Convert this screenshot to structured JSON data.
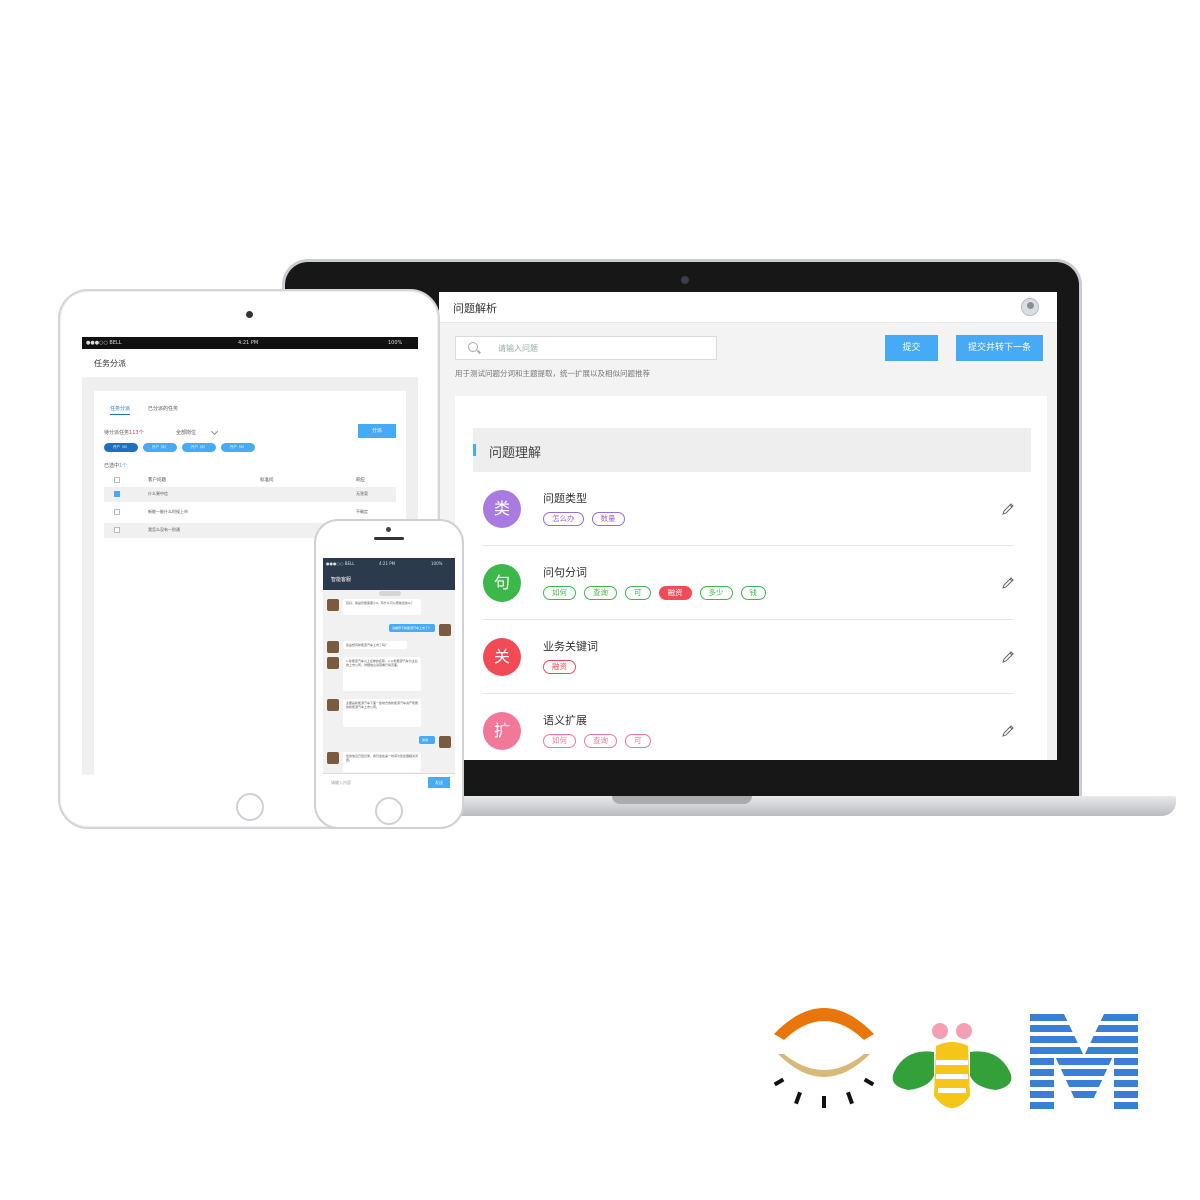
{
  "laptop": {
    "page_title": "问题解析",
    "search_placeholder": "请输入问题",
    "submit_label": "提交",
    "submit_next_label": "提交并转下一条",
    "hint": "用于测试问题分词和主题提取，统一扩展以及相似问题推荐",
    "section_title": "问题理解",
    "rows": [
      {
        "badge": "类",
        "badge_color": "#a97be0",
        "title": "问题类型",
        "tags": [
          {
            "text": "怎么办",
            "style": "purple"
          },
          {
            "text": "数量",
            "style": "purple"
          }
        ]
      },
      {
        "badge": "句",
        "badge_color": "#3cb84a",
        "title": "问句分词",
        "tags": [
          {
            "text": "如何",
            "style": "green"
          },
          {
            "text": "查询",
            "style": "green"
          },
          {
            "text": "可",
            "style": "green"
          },
          {
            "text": "融资",
            "style": "red-solid"
          },
          {
            "text": "多少",
            "style": "green"
          },
          {
            "text": "钱",
            "style": "green"
          }
        ]
      },
      {
        "badge": "关",
        "badge_color": "#f24b57",
        "title": "业务关键词",
        "tags": [
          {
            "text": "融资",
            "style": "red"
          }
        ]
      },
      {
        "badge": "扩",
        "badge_color": "#f2789a",
        "title": "语义扩展",
        "tags": [
          {
            "text": "如何",
            "style": "pink"
          },
          {
            "text": "查询",
            "style": "pink"
          },
          {
            "text": "可",
            "style": "pink"
          }
        ]
      }
    ],
    "colors": {
      "accent": "#47aaf7"
    }
  },
  "tablet": {
    "status_carrier": "●●●○○ BELL",
    "status_time": "4:21 PM",
    "status_battery": "100%",
    "nav_title": "任务分派",
    "tabs": [
      "任务分派",
      "已分派的任务"
    ],
    "pending_prefix": "待分派任务",
    "pending_count": "113",
    "pending_suffix": "个",
    "filter_value": "全部岗位",
    "assign_label": "分派",
    "chips": [
      "开户（8）",
      "开户（8）",
      "开户（8）",
      "开户（8）"
    ],
    "selected_prefix": "已选中",
    "selected_count": "1个",
    "headers": [
      "客户问题",
      "标准问",
      "响应"
    ],
    "rows": [
      {
        "question": "什么果中信",
        "answer": "无答案",
        "checked": true
      },
      {
        "question": "新能一能什么时候上市",
        "answer": "不确定",
        "checked": false
      },
      {
        "question": "我怎么没有一阶通",
        "answer": "",
        "checked": false
      }
    ]
  },
  "phone": {
    "status_carrier": "●●●○○ BELL",
    "status_time": "4:21 PM",
    "status_battery": "100%",
    "nav_title": "智能客服",
    "messages": [
      {
        "side": "in",
        "text": "您好，我是智能客服小S，有什么可以帮助您的么？"
      },
      {
        "side": "out",
        "text": "请推荐下新能源汽车上市了？"
      },
      {
        "side": "in",
        "text": "您是想问新能源汽车上市了吗？"
      },
      {
        "side": "in",
        "text": "1.新能源汽车以上证券的名称，2.以新能源汽车为主业的上市公司，详细信息请查看行情页面。"
      },
      {
        "side": "in",
        "text": "主要是新能源汽车下面一些地方的新能源汽车资产所属的新能源汽车上市公司。"
      },
      {
        "side": "out",
        "text": "谢谢"
      },
      {
        "side": "in",
        "text": "您的信息已经记录，我们会在第一时间为您处理相关问题。"
      }
    ],
    "input_placeholder": "请输入内容",
    "send_label": "发送"
  },
  "logo": {
    "colors": {
      "orange": "#e8760b",
      "tan": "#d9b978",
      "green": "#34a03a",
      "yellow": "#f5c518",
      "pink": "#f3a0b5",
      "blue": "#3a7fd6"
    }
  }
}
